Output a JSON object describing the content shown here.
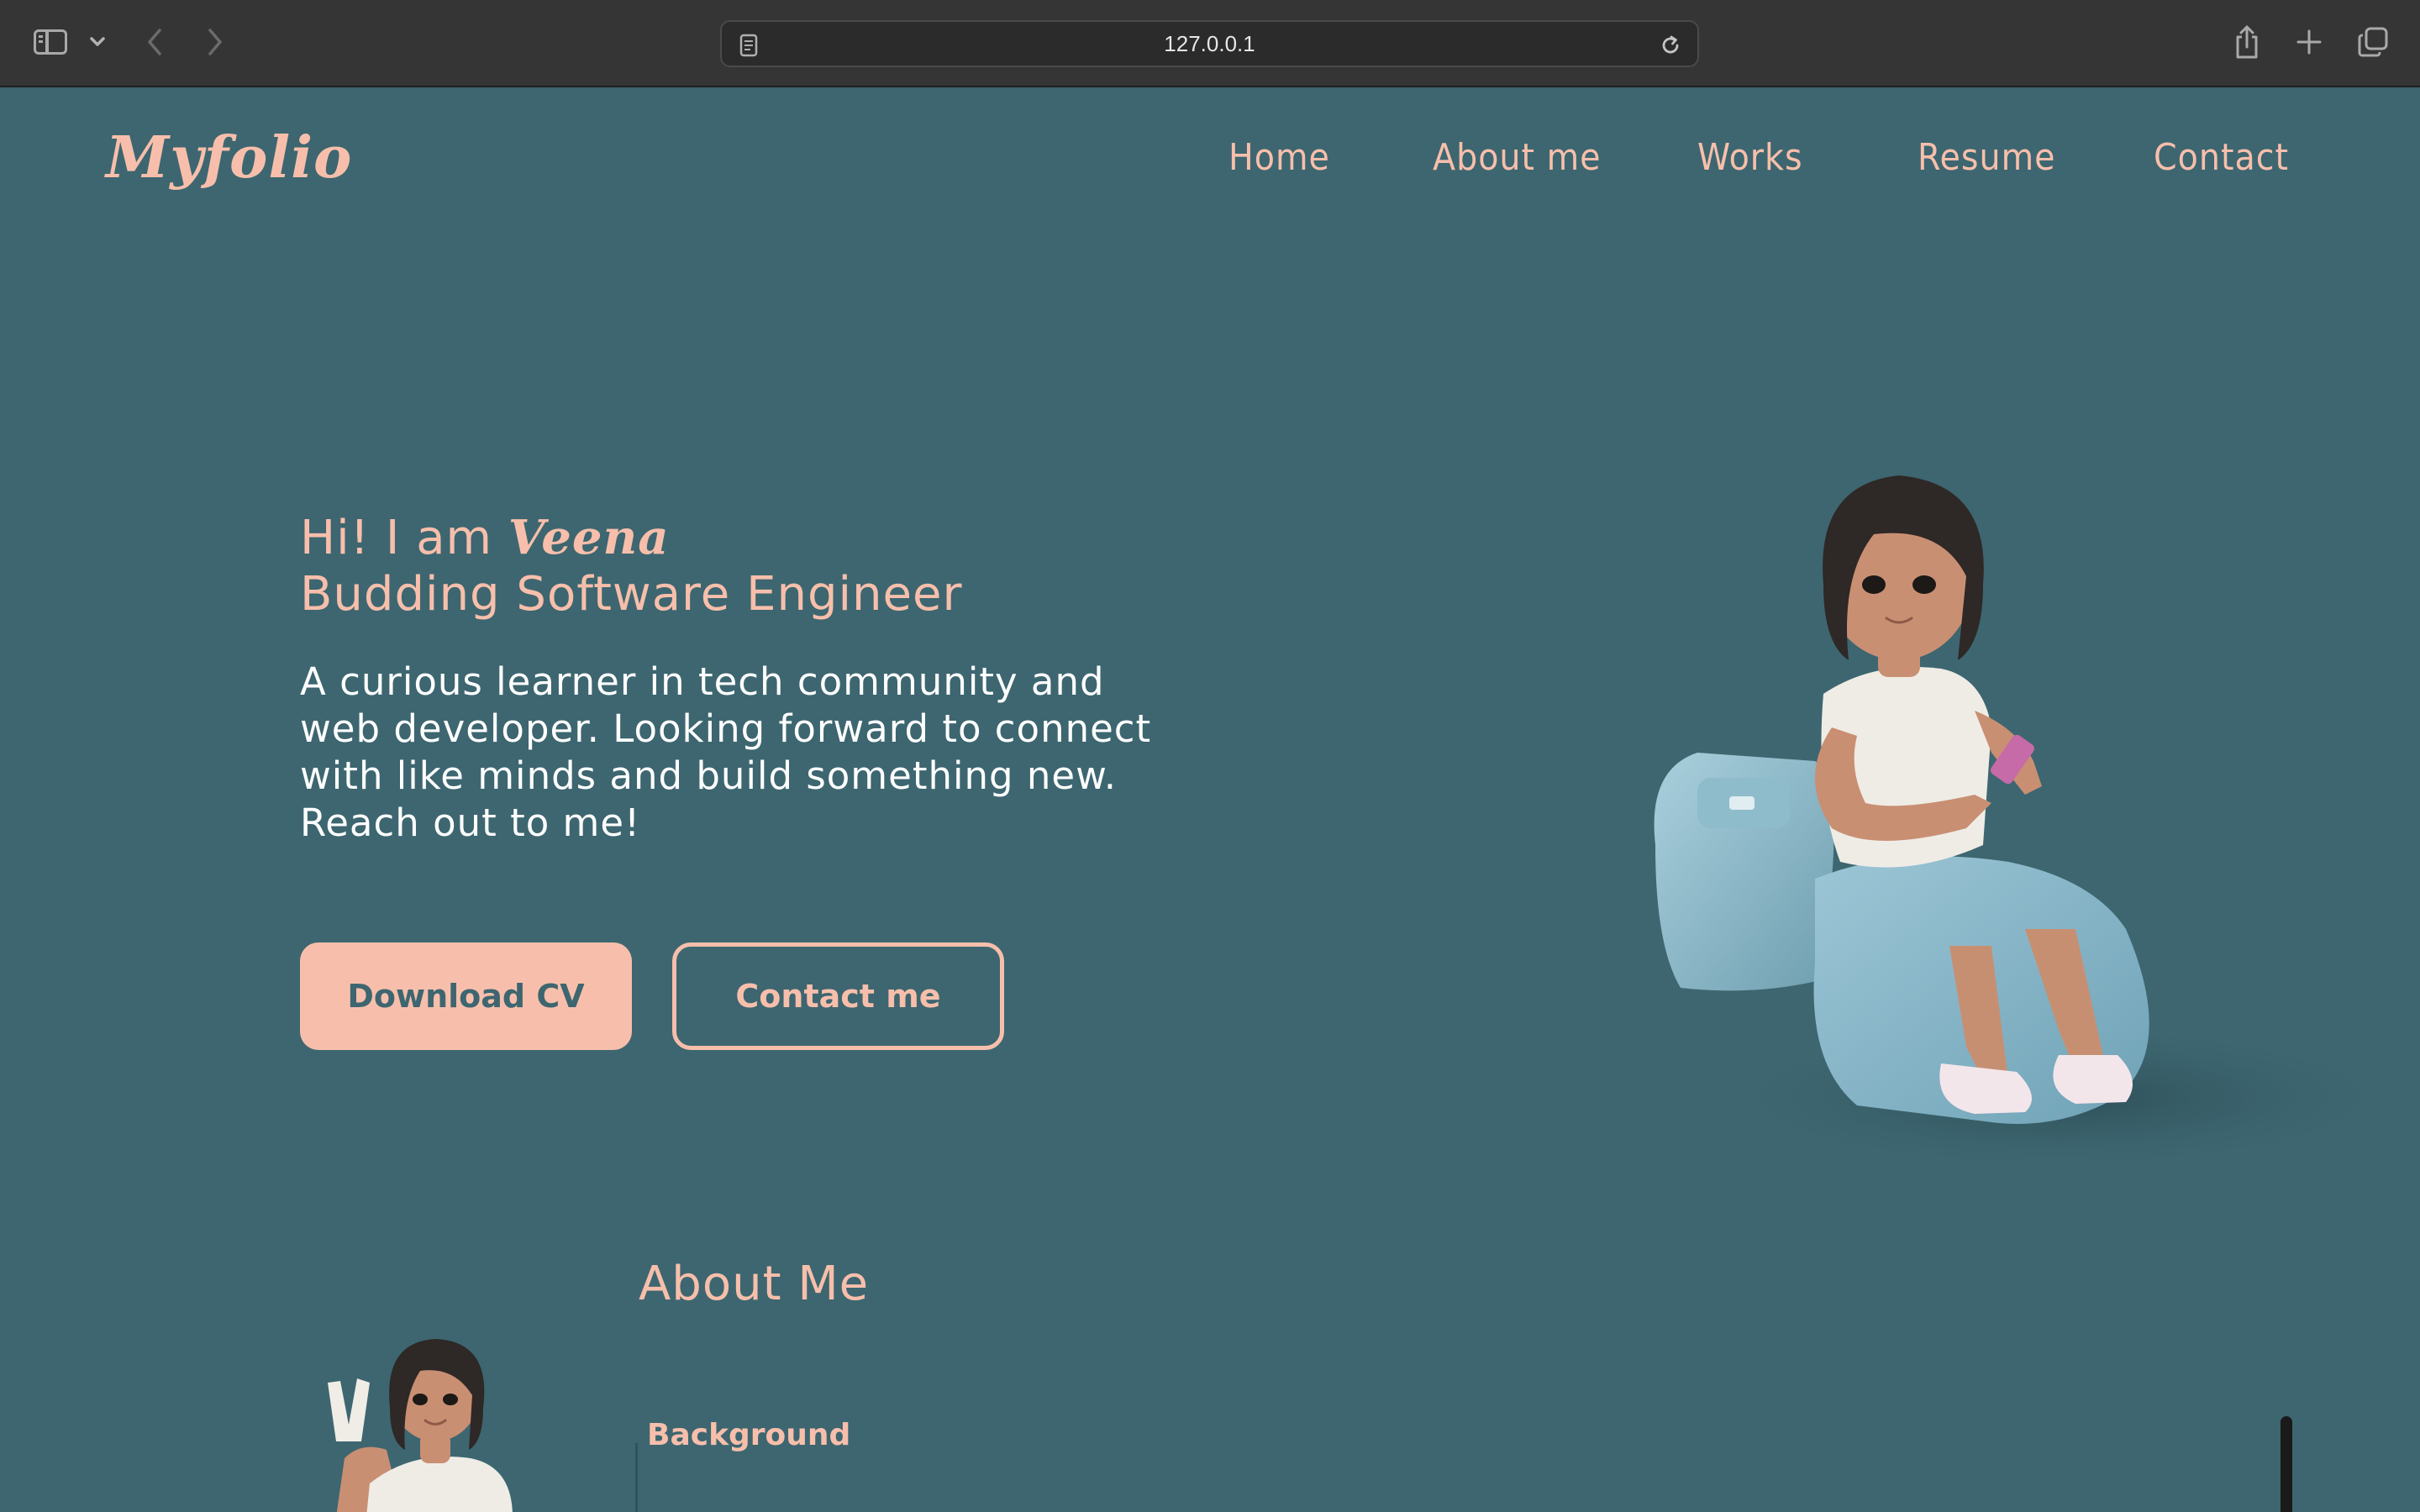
{
  "browser": {
    "url": "127.0.0.1"
  },
  "site": {
    "logo": "Myfolio",
    "nav": [
      "Home",
      "About me",
      "Works",
      "Resume",
      "Contact"
    ]
  },
  "hero": {
    "greeting_prefix": "Hi! I am ",
    "name": "Veena",
    "role": "Budding Software Engineer",
    "description": "A curious learner in tech community and web developer. Looking forward to connect with like minds and build something new. Reach out to me!",
    "primary_button": "Download CV",
    "secondary_button": "Contact me"
  },
  "about": {
    "title": "About Me",
    "subtitle": "Background"
  },
  "colors": {
    "background": "#3d6670",
    "accent": "#f7bfab",
    "text_light": "#ffffff"
  }
}
